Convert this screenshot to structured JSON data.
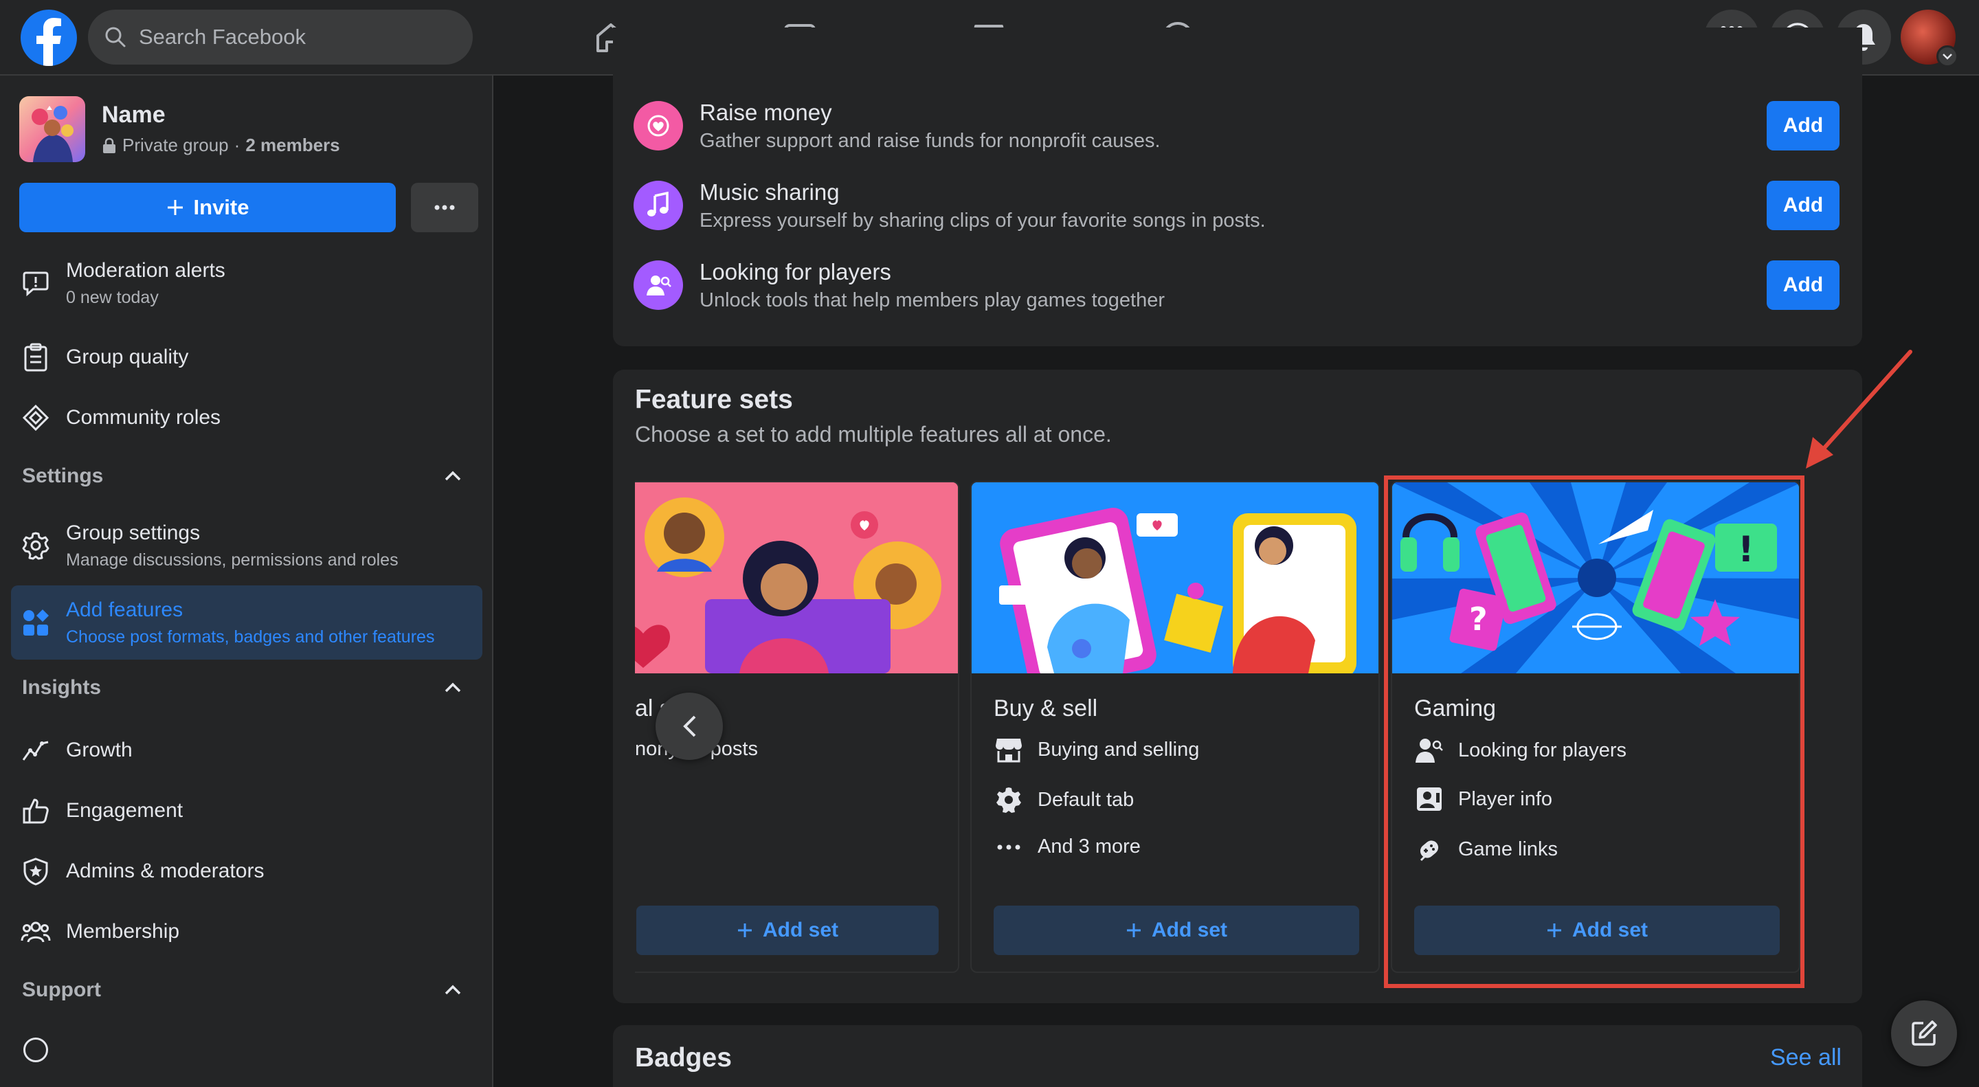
{
  "topbar": {
    "search_placeholder": "Search Facebook",
    "nav_icons": [
      "home-icon",
      "video-icon",
      "marketplace-icon",
      "groups-icon",
      "gaming-icon"
    ],
    "right_icons": [
      "menu-grid-icon",
      "messenger-icon",
      "notifications-icon"
    ]
  },
  "group": {
    "name": "Name",
    "privacy": "Private group",
    "separator": "·",
    "members": "2 members",
    "invite_label": "Invite"
  },
  "sidebar": {
    "items": [
      {
        "label": "Moderation alerts",
        "sub": "0 new today"
      },
      {
        "label": "Group quality"
      },
      {
        "label": "Community roles"
      }
    ],
    "settings": {
      "heading": "Settings",
      "items": [
        {
          "label": "Group settings",
          "sub": "Manage discussions, permissions and roles"
        },
        {
          "label": "Add features",
          "sub": "Choose post formats, badges and other features"
        }
      ]
    },
    "insights": {
      "heading": "Insights",
      "items": [
        {
          "label": "Growth"
        },
        {
          "label": "Engagement"
        },
        {
          "label": "Admins & moderators"
        },
        {
          "label": "Membership"
        }
      ]
    },
    "support": {
      "heading": "Support"
    }
  },
  "features": [
    {
      "title": "Raise money",
      "desc": "Gather support and raise funds for nonprofit causes.",
      "button": "Add",
      "icon_color": "#f35aa4"
    },
    {
      "title": "Music sharing",
      "desc": "Express yourself by sharing clips of your favorite songs in posts.",
      "button": "Add",
      "icon_color": "#a35bff"
    },
    {
      "title": "Looking for players",
      "desc": "Unlock tools that help members play games together",
      "button": "Add",
      "icon_color": "#a35bff"
    }
  ],
  "feature_sets": {
    "title": "Feature sets",
    "subtitle": "Choose a set to add multiple features all at once.",
    "sets": [
      {
        "name": "al s  rt",
        "features": [
          "nony  us posts"
        ],
        "button": "Add set"
      },
      {
        "name": "Buy & sell",
        "features": [
          "Buying and selling",
          "Default tab",
          "And 3 more"
        ],
        "button": "Add set"
      },
      {
        "name": "Gaming",
        "features": [
          "Looking for players",
          "Player info",
          "Game links"
        ],
        "button": "Add set"
      }
    ]
  },
  "badges": {
    "title": "Badges",
    "see_all": "See all"
  },
  "colors": {
    "accent": "#1877f2",
    "highlight": "#e0453a",
    "link": "#4599ff"
  }
}
